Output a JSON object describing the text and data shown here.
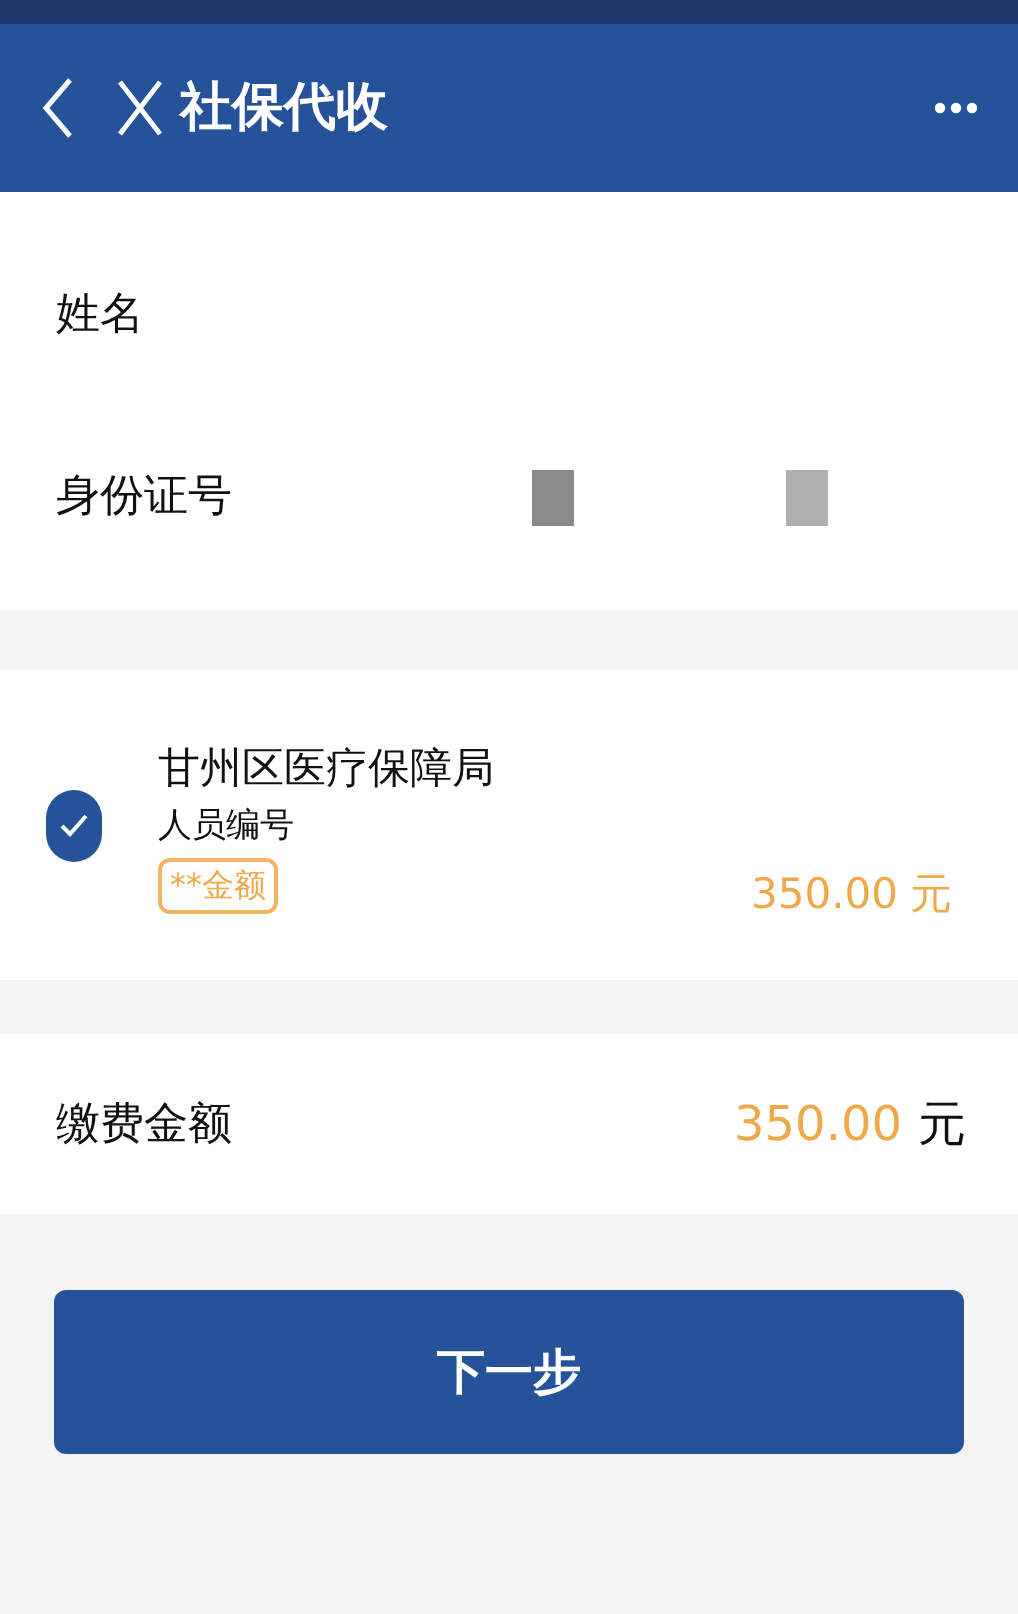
{
  "header": {
    "title": "社保代收"
  },
  "info_rows": [
    {
      "label": "姓名",
      "redacted": false
    },
    {
      "label": "身份证号",
      "redacted": true
    }
  ],
  "item": {
    "checked": true,
    "org": "甘州区医疗保障局",
    "id_label": "人员编号",
    "tag": "**金额",
    "amount": "350.00",
    "unit": "元"
  },
  "total": {
    "label": "缴费金额",
    "amount": "350.00",
    "unit": "元"
  },
  "button": "下一步"
}
